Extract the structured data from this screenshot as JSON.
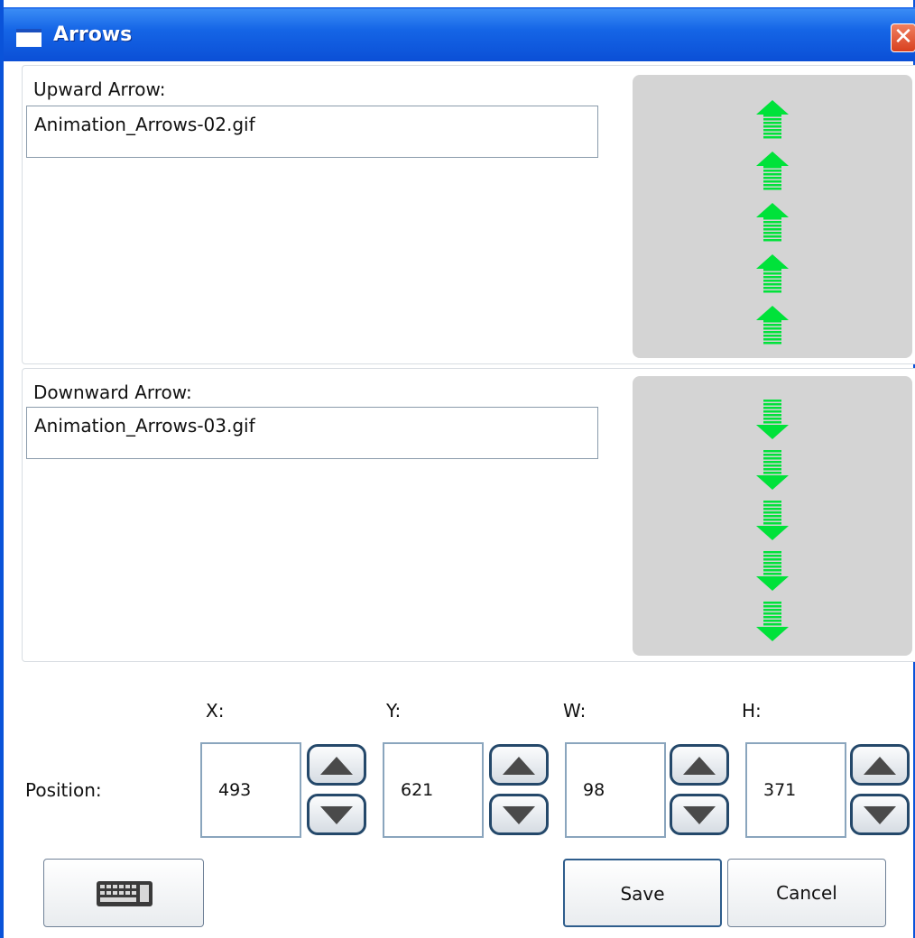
{
  "window": {
    "title": "Arrows",
    "close_symbol": "✕"
  },
  "upward": {
    "label": "Upward Arrow:",
    "filename": "Animation_Arrows-02.gif",
    "preview_icon": "green-up-arrows-icon",
    "preview_color": "#00e23a"
  },
  "downward": {
    "label": "Downward Arrow:",
    "filename": "Animation_Arrows-03.gif",
    "preview_icon": "green-down-arrows-icon",
    "preview_color": "#00e23a"
  },
  "position": {
    "label": "Position:",
    "x_label": "X:",
    "y_label": "Y:",
    "w_label": "W:",
    "h_label": "H:",
    "x": "493",
    "y": "621",
    "w": "98",
    "h": "371"
  },
  "buttons": {
    "keyboard_icon": "keyboard-icon",
    "save": "Save",
    "cancel": "Cancel"
  }
}
